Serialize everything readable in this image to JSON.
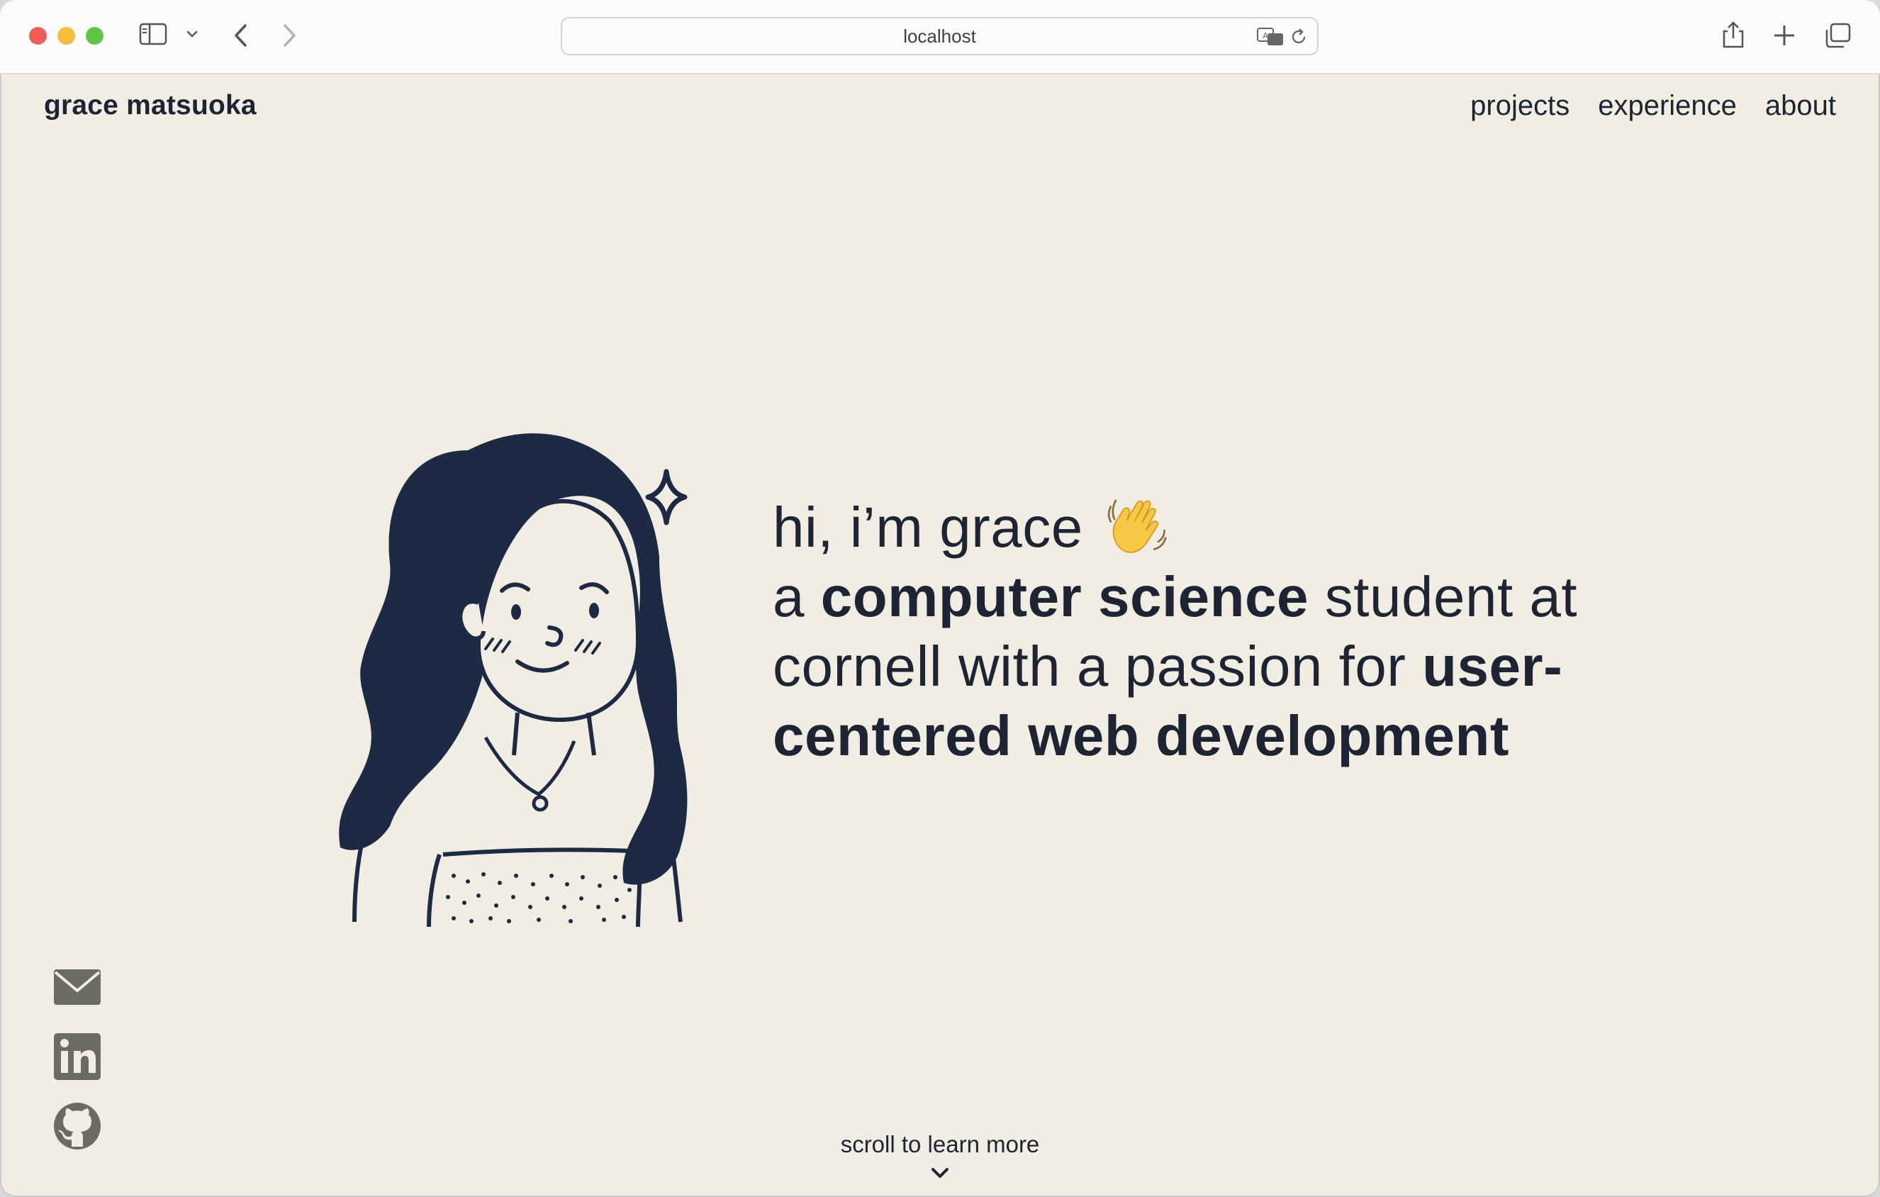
{
  "browser": {
    "url": "localhost"
  },
  "site": {
    "name": "grace matsuoka",
    "nav": [
      {
        "label": "projects"
      },
      {
        "label": "experience"
      },
      {
        "label": "about"
      }
    ]
  },
  "hero": {
    "greeting": "hi, i’m grace",
    "wave_emoji": "waving-hand",
    "intro_a": "a",
    "intro_bold_1": "computer science",
    "intro_mid": "student at cornell with a passion for",
    "intro_bold_2": "user-centered web development"
  },
  "socials": [
    {
      "icon": "mail-icon"
    },
    {
      "icon": "linkedin-icon"
    },
    {
      "icon": "github-icon"
    }
  ],
  "scroll": {
    "label": "scroll to learn more"
  },
  "colors": {
    "background": "#f1ede3",
    "text": "#1d2433",
    "icon": "#6b6a63"
  }
}
